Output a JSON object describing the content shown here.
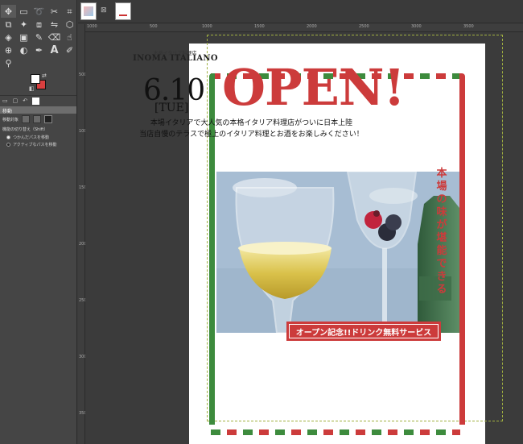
{
  "app": {
    "tools": [
      "move-icon",
      "rect-select-icon",
      "lasso-icon",
      "scissors-icon",
      "crop-icon",
      "unified-transform-icon",
      "warp-icon",
      "perspective-icon",
      "flip-icon",
      "cage-icon",
      "bucket-fill-icon",
      "gradient-icon",
      "paintbrush-icon",
      "eraser-icon",
      "smudge-icon",
      "clone-icon",
      "dodge-icon",
      "path-icon",
      "text-icon",
      "color-picker-icon",
      "zoom-icon"
    ],
    "colors": {
      "foreground": "#ffffff",
      "background": "#d93f3f"
    }
  },
  "tool_options": {
    "title": "移動",
    "target_label": "移動対象",
    "toggle_label": "機能の切り替え（Shift）",
    "option_a": "つかんだパスを移動",
    "option_b": "アクティブなパスを移動"
  },
  "rulers": {
    "top": [
      "1000",
      "500",
      "1000",
      "1500",
      "2000",
      "2500",
      "3000",
      "3500"
    ],
    "left": [
      "500",
      "1000",
      "1500",
      "2000",
      "2500",
      "3000",
      "3500"
    ]
  },
  "poster": {
    "shop_sub": "本格イタリア料理店",
    "shop_name": "INOMA ITALIANO",
    "date": "6.10",
    "dow": "[TUE]",
    "headline": "OPEN!",
    "line1": "本場イタリアで大人気の本格イタリア料理店がついに日本上陸",
    "line2": "当店自慢のテラスで極上のイタリア料理とお酒をお楽しみください！",
    "tagline": "本場の味が堪能できる",
    "promo": "オープン記念!!ドリンク無料サービス",
    "colors": {
      "red": "#cc3b3b",
      "green": "#3d8b3d"
    }
  }
}
